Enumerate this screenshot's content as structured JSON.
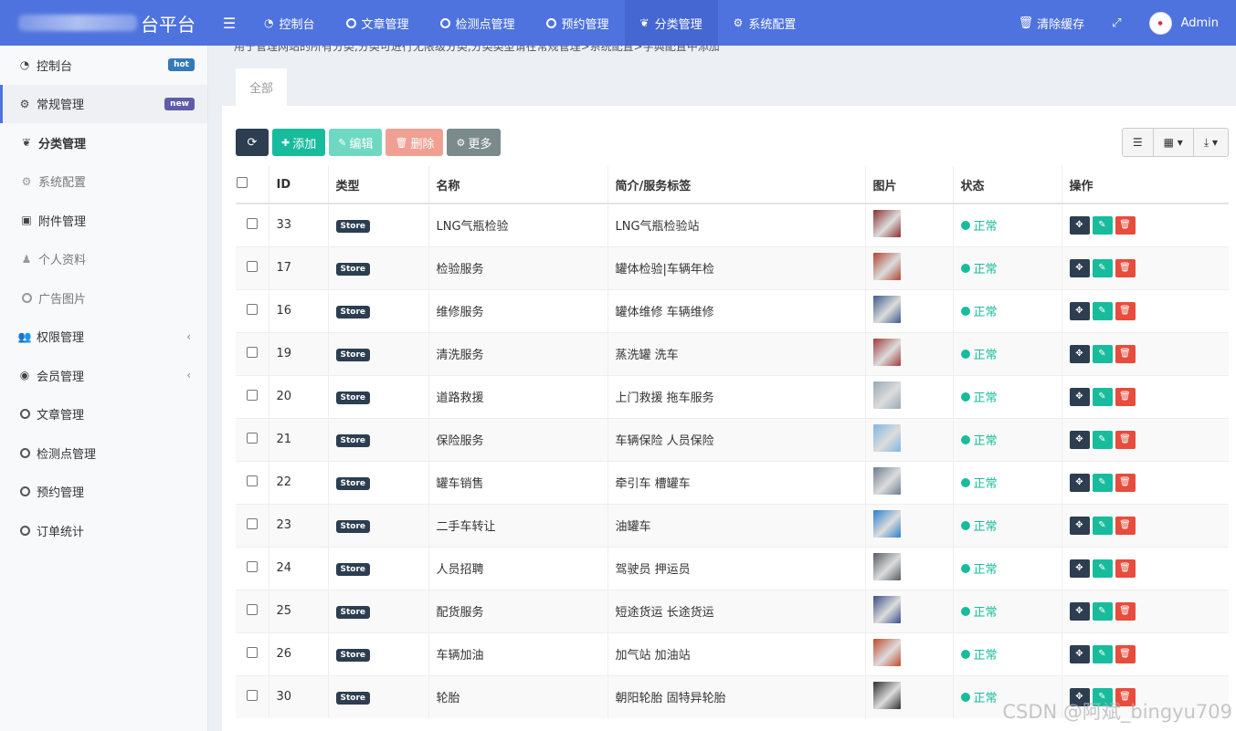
{
  "header": {
    "logo_suffix": "台平台",
    "nav": [
      {
        "label": "控制台",
        "icon": "dashboard-icon"
      },
      {
        "label": "文章管理",
        "icon": "circle-icon"
      },
      {
        "label": "检测点管理",
        "icon": "circle-icon"
      },
      {
        "label": "预约管理",
        "icon": "circle-icon"
      },
      {
        "label": "分类管理",
        "icon": "leaf-icon"
      },
      {
        "label": "系统配置",
        "icon": "gear-icon"
      }
    ],
    "clear_cache": "清除缓存",
    "user": "Admin"
  },
  "sidebar": {
    "items": [
      {
        "label": "控制台",
        "badge": "hot"
      },
      {
        "label": "常规管理",
        "badge": "new"
      },
      {
        "label": "分类管理"
      },
      {
        "label": "系统配置"
      },
      {
        "label": "附件管理"
      },
      {
        "label": "个人资料"
      },
      {
        "label": "广告图片"
      },
      {
        "label": "权限管理"
      },
      {
        "label": "会员管理"
      },
      {
        "label": "文章管理"
      },
      {
        "label": "检测点管理"
      },
      {
        "label": "预约管理"
      },
      {
        "label": "订单统计"
      }
    ]
  },
  "page": {
    "description": "用于管理网站的所有分类,分类可进行无限级分类,分类类型请在常规管理>系统配置>字典配置中添加",
    "tab_all": "全部"
  },
  "toolbar": {
    "add": "添加",
    "edit": "编辑",
    "delete": "删除",
    "more": "更多"
  },
  "table": {
    "columns": [
      "ID",
      "类型",
      "名称",
      "简介/服务标签",
      "图片",
      "状态",
      "操作"
    ],
    "rows": [
      {
        "id": "33",
        "type": "Store",
        "name": "LNG气瓶检验",
        "desc": "LNG气瓶检验站",
        "status": "正常",
        "color": "#8b2e2e"
      },
      {
        "id": "17",
        "type": "Store",
        "name": "检验服务",
        "desc": "罐体检验|车辆年检",
        "status": "正常",
        "color": "#b0442f"
      },
      {
        "id": "16",
        "type": "Store",
        "name": "维修服务",
        "desc": "罐体维修 车辆维修",
        "status": "正常",
        "color": "#3b5a8a"
      },
      {
        "id": "19",
        "type": "Store",
        "name": "清洗服务",
        "desc": "蒸洗罐 洗车",
        "status": "正常",
        "color": "#a23a3a"
      },
      {
        "id": "20",
        "type": "Store",
        "name": "道路救援",
        "desc": "上门救援 拖车服务",
        "status": "正常",
        "color": "#9aa8b5"
      },
      {
        "id": "21",
        "type": "Store",
        "name": "保险服务",
        "desc": "车辆保险 人员保险",
        "status": "正常",
        "color": "#7fb6e0"
      },
      {
        "id": "22",
        "type": "Store",
        "name": "罐车销售",
        "desc": "牵引车 槽罐车",
        "status": "正常",
        "color": "#6c7d8f"
      },
      {
        "id": "23",
        "type": "Store",
        "name": "二手车转让",
        "desc": "油罐车",
        "status": "正常",
        "color": "#2a7fd0"
      },
      {
        "id": "24",
        "type": "Store",
        "name": "人员招聘",
        "desc": "驾驶员 押运员",
        "status": "正常",
        "color": "#555b63"
      },
      {
        "id": "25",
        "type": "Store",
        "name": "配货服务",
        "desc": "短途货运 长途货运",
        "status": "正常",
        "color": "#3a4c8c"
      },
      {
        "id": "26",
        "type": "Store",
        "name": "车辆加油",
        "desc": "加气站 加油站",
        "status": "正常",
        "color": "#c0492c"
      },
      {
        "id": "30",
        "type": "Store",
        "name": "轮胎",
        "desc": "朝阳轮胎 固特异轮胎",
        "status": "正常",
        "color": "#2e2e2e"
      }
    ]
  },
  "watermark": "CSDN @阿斌_bingyu709"
}
